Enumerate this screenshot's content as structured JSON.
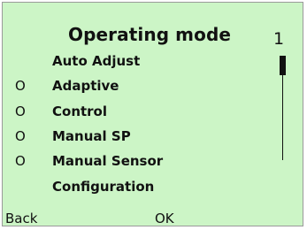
{
  "screen": {
    "title": "Operating mode",
    "page_number": "1",
    "background_color": "#ccf5c6",
    "scroll_position": 0
  },
  "menu": {
    "items": [
      {
        "label": "Auto Adjust",
        "marker": ""
      },
      {
        "label": "Adaptive",
        "marker": "O"
      },
      {
        "label": "Control",
        "marker": "O"
      },
      {
        "label": "Manual SP",
        "marker": "O"
      },
      {
        "label": "Manual Sensor",
        "marker": "O"
      },
      {
        "label": "Configuration",
        "marker": ""
      }
    ]
  },
  "softkeys": {
    "left": "Back",
    "right": "OK"
  }
}
